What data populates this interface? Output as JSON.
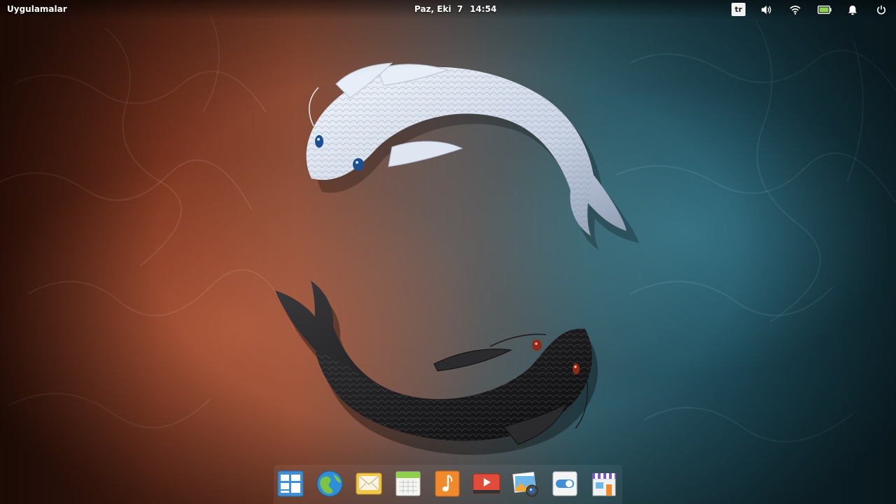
{
  "top_panel": {
    "apps_menu_label": "Uygulamalar",
    "date": "Paz, Eki  7",
    "time": "14:54",
    "keyboard_layout": "tr"
  },
  "indicators": [
    {
      "name": "keyboard-layout",
      "icon": "keyboard-layout-icon"
    },
    {
      "name": "sound",
      "icon": "volume-icon"
    },
    {
      "name": "network",
      "icon": "wifi-icon"
    },
    {
      "name": "power",
      "icon": "battery-icon"
    },
    {
      "name": "notifications",
      "icon": "bell-icon"
    },
    {
      "name": "session",
      "icon": "power-icon"
    }
  ],
  "dock": {
    "items": [
      {
        "app": "multitasking-view",
        "icon": "multitasking-icon"
      },
      {
        "app": "web-browser",
        "icon": "globe-icon"
      },
      {
        "app": "mail",
        "icon": "mail-icon"
      },
      {
        "app": "calendar",
        "icon": "calendar-icon"
      },
      {
        "app": "music",
        "icon": "music-icon"
      },
      {
        "app": "videos",
        "icon": "video-player-icon"
      },
      {
        "app": "photos",
        "icon": "photos-icon"
      },
      {
        "app": "system-settings",
        "icon": "settings-toggle-icon"
      },
      {
        "app": "appcenter",
        "icon": "store-icon"
      }
    ]
  },
  "colors": {
    "wallpaper_warm": "#8c4a33",
    "wallpaper_cool": "#1f4d5c",
    "panel_text": "#ffffff",
    "battery_fill": "#8bd449"
  }
}
